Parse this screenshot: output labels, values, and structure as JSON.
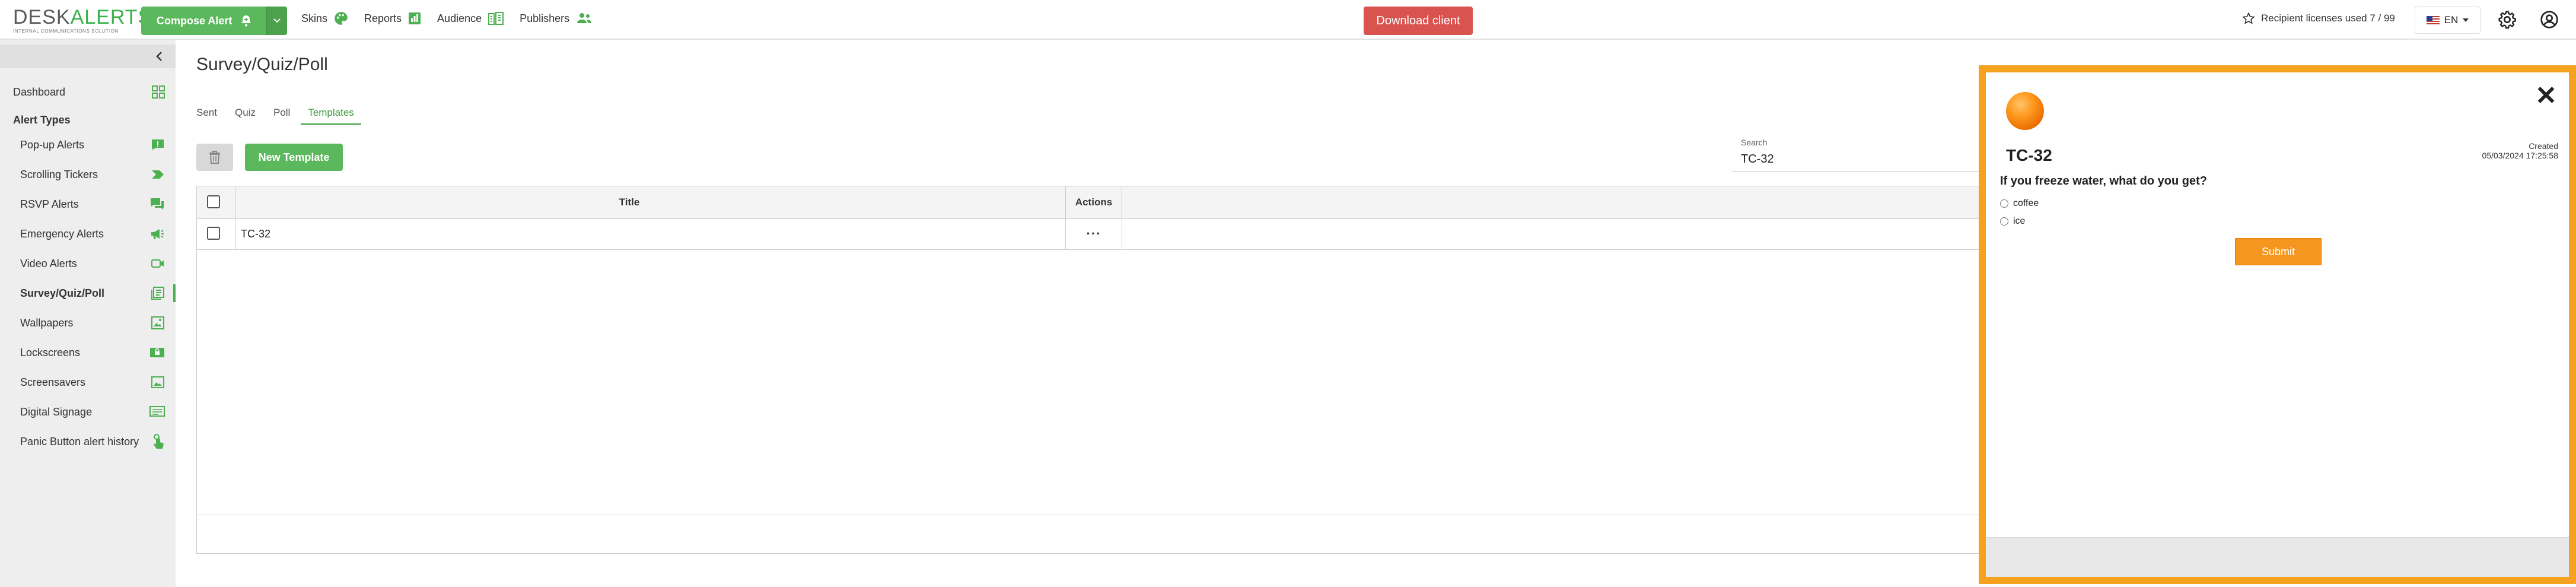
{
  "brand": {
    "logo_left": "DESK",
    "logo_right": "ALERTS",
    "tagline": "INTERNAL COMMUNICATIONS SOLUTION"
  },
  "header": {
    "compose_label": "Compose Alert",
    "nav": [
      {
        "label": "Skins",
        "icon": "palette-icon"
      },
      {
        "label": "Reports",
        "icon": "bar-chart-icon"
      },
      {
        "label": "Audience",
        "icon": "org-chart-icon"
      },
      {
        "label": "Publishers",
        "icon": "users-icon"
      }
    ],
    "download_label": "Download client",
    "licenses_text": "Recipient licenses used 7 / 99",
    "language": "EN"
  },
  "sidebar": {
    "dashboard_label": "Dashboard",
    "section_heading": "Alert Types",
    "items": [
      {
        "label": "Pop-up Alerts",
        "icon": "popup-alert-icon"
      },
      {
        "label": "Scrolling Tickers",
        "icon": "ticker-icon"
      },
      {
        "label": "RSVP Alerts",
        "icon": "rsvp-icon"
      },
      {
        "label": "Emergency Alerts",
        "icon": "megaphone-icon"
      },
      {
        "label": "Video Alerts",
        "icon": "video-icon"
      },
      {
        "label": "Survey/Quiz/Poll",
        "icon": "survey-icon",
        "active": true
      },
      {
        "label": "Wallpapers",
        "icon": "wallpaper-icon"
      },
      {
        "label": "Lockscreens",
        "icon": "lockscreen-icon"
      },
      {
        "label": "Screensavers",
        "icon": "screensaver-icon"
      },
      {
        "label": "Digital Signage",
        "icon": "signage-icon"
      },
      {
        "label": "Panic Button alert history",
        "icon": "panic-button-icon"
      }
    ]
  },
  "main": {
    "title": "Survey/Quiz/Poll",
    "tabs": [
      "Sent",
      "Quiz",
      "Poll",
      "Templates"
    ],
    "active_tab": "Templates",
    "new_template_label": "New Template",
    "search": {
      "label": "Search",
      "value": "TC-32"
    },
    "table": {
      "columns": [
        "Title",
        "Actions"
      ],
      "rows": [
        {
          "title": "TC-32",
          "actions": "···"
        }
      ]
    }
  },
  "preview": {
    "title": "TC-32",
    "created_label": "Created",
    "created_date": "05/03/2024 17:25:58",
    "question": "If you freeze water, what do you get?",
    "options": [
      "coffee",
      "ice"
    ],
    "submit_label": "Submit",
    "border_color": "#f5a21f"
  },
  "colors": {
    "accent_green": "#5cb85c",
    "danger_red": "#d9534f",
    "preview_orange": "#f5a21f"
  }
}
